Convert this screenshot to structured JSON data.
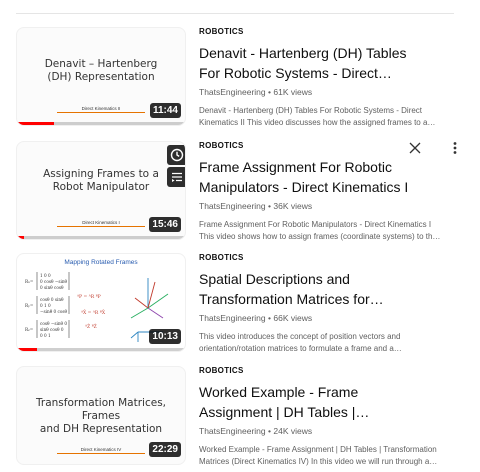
{
  "videos": [
    {
      "category": "ROBOTICS",
      "title_line1": "Denavit - Hartenberg (DH) Tables",
      "title_line2": "For Robotic Systems - Direct…",
      "channel": "ThatsEngineering",
      "views": "61K views",
      "desc_line1": "Denavit - Hartenberg (DH) Tables For Robotic Systems - Direct",
      "desc_line2": "Kinematics II This video discusses how the assigned frames to a…",
      "duration": "11:44",
      "progress": 0.22,
      "thumb_title": "Denavit – Hartenberg\n(DH) Representation",
      "thumb_footer": "Direct Kinematics II"
    },
    {
      "category": "ROBOTICS",
      "title_line1": "Frame Assignment For Robotic",
      "title_line2": "Manipulators - Direct Kinematics I",
      "channel": "ThatsEngineering",
      "views": "36K views",
      "desc_line1": "Frame Assignment For Robotic Manipulators - Direct Kinematics I",
      "desc_line2": "This video shows how to assign frames (coordinate systems) to th…",
      "duration": "15:46",
      "progress": 0.04,
      "thumb_title": "Assigning Frames to a\nRobot Manipulator",
      "thumb_footer": "Direct Kinematics I"
    },
    {
      "category": "ROBOTICS",
      "title_line1": "Spatial Descriptions and",
      "title_line2": "Transformation Matrices for…",
      "channel": "ThatsEngineering",
      "views": "66K views",
      "desc_line1": "This video introduces the concept of position vectors and",
      "desc_line2": "orientation/rotation matrices to formulate a frame and a…",
      "duration": "10:13",
      "progress": 0.12,
      "thumb_title": "Mapping Rotated Frames",
      "thumb_footer": ""
    },
    {
      "category": "ROBOTICS",
      "title_line1": "Worked Example - Frame",
      "title_line2": "Assignment | DH Tables |…",
      "channel": "ThatsEngineering",
      "views": "24K views",
      "desc_line1": "Worked Example - Frame Assignment | DH Tables | Transformation",
      "desc_line2": "Matrices (Direct Kinematics IV) In this video we will run through a…",
      "duration": "22:29",
      "progress": 0.0,
      "thumb_title": "Transformation Matrices,\nFrames\nand DH Representation",
      "thumb_footer": "Direct Kinematics IV"
    }
  ],
  "channel_separator": "•",
  "icons": {
    "watch_later": "clock-icon",
    "add_to_queue": "queue-icon",
    "dismiss": "close-icon",
    "more": "more-vert-icon"
  },
  "colors": {
    "progress": "#ff0000",
    "accent_rule": "#e57300"
  }
}
